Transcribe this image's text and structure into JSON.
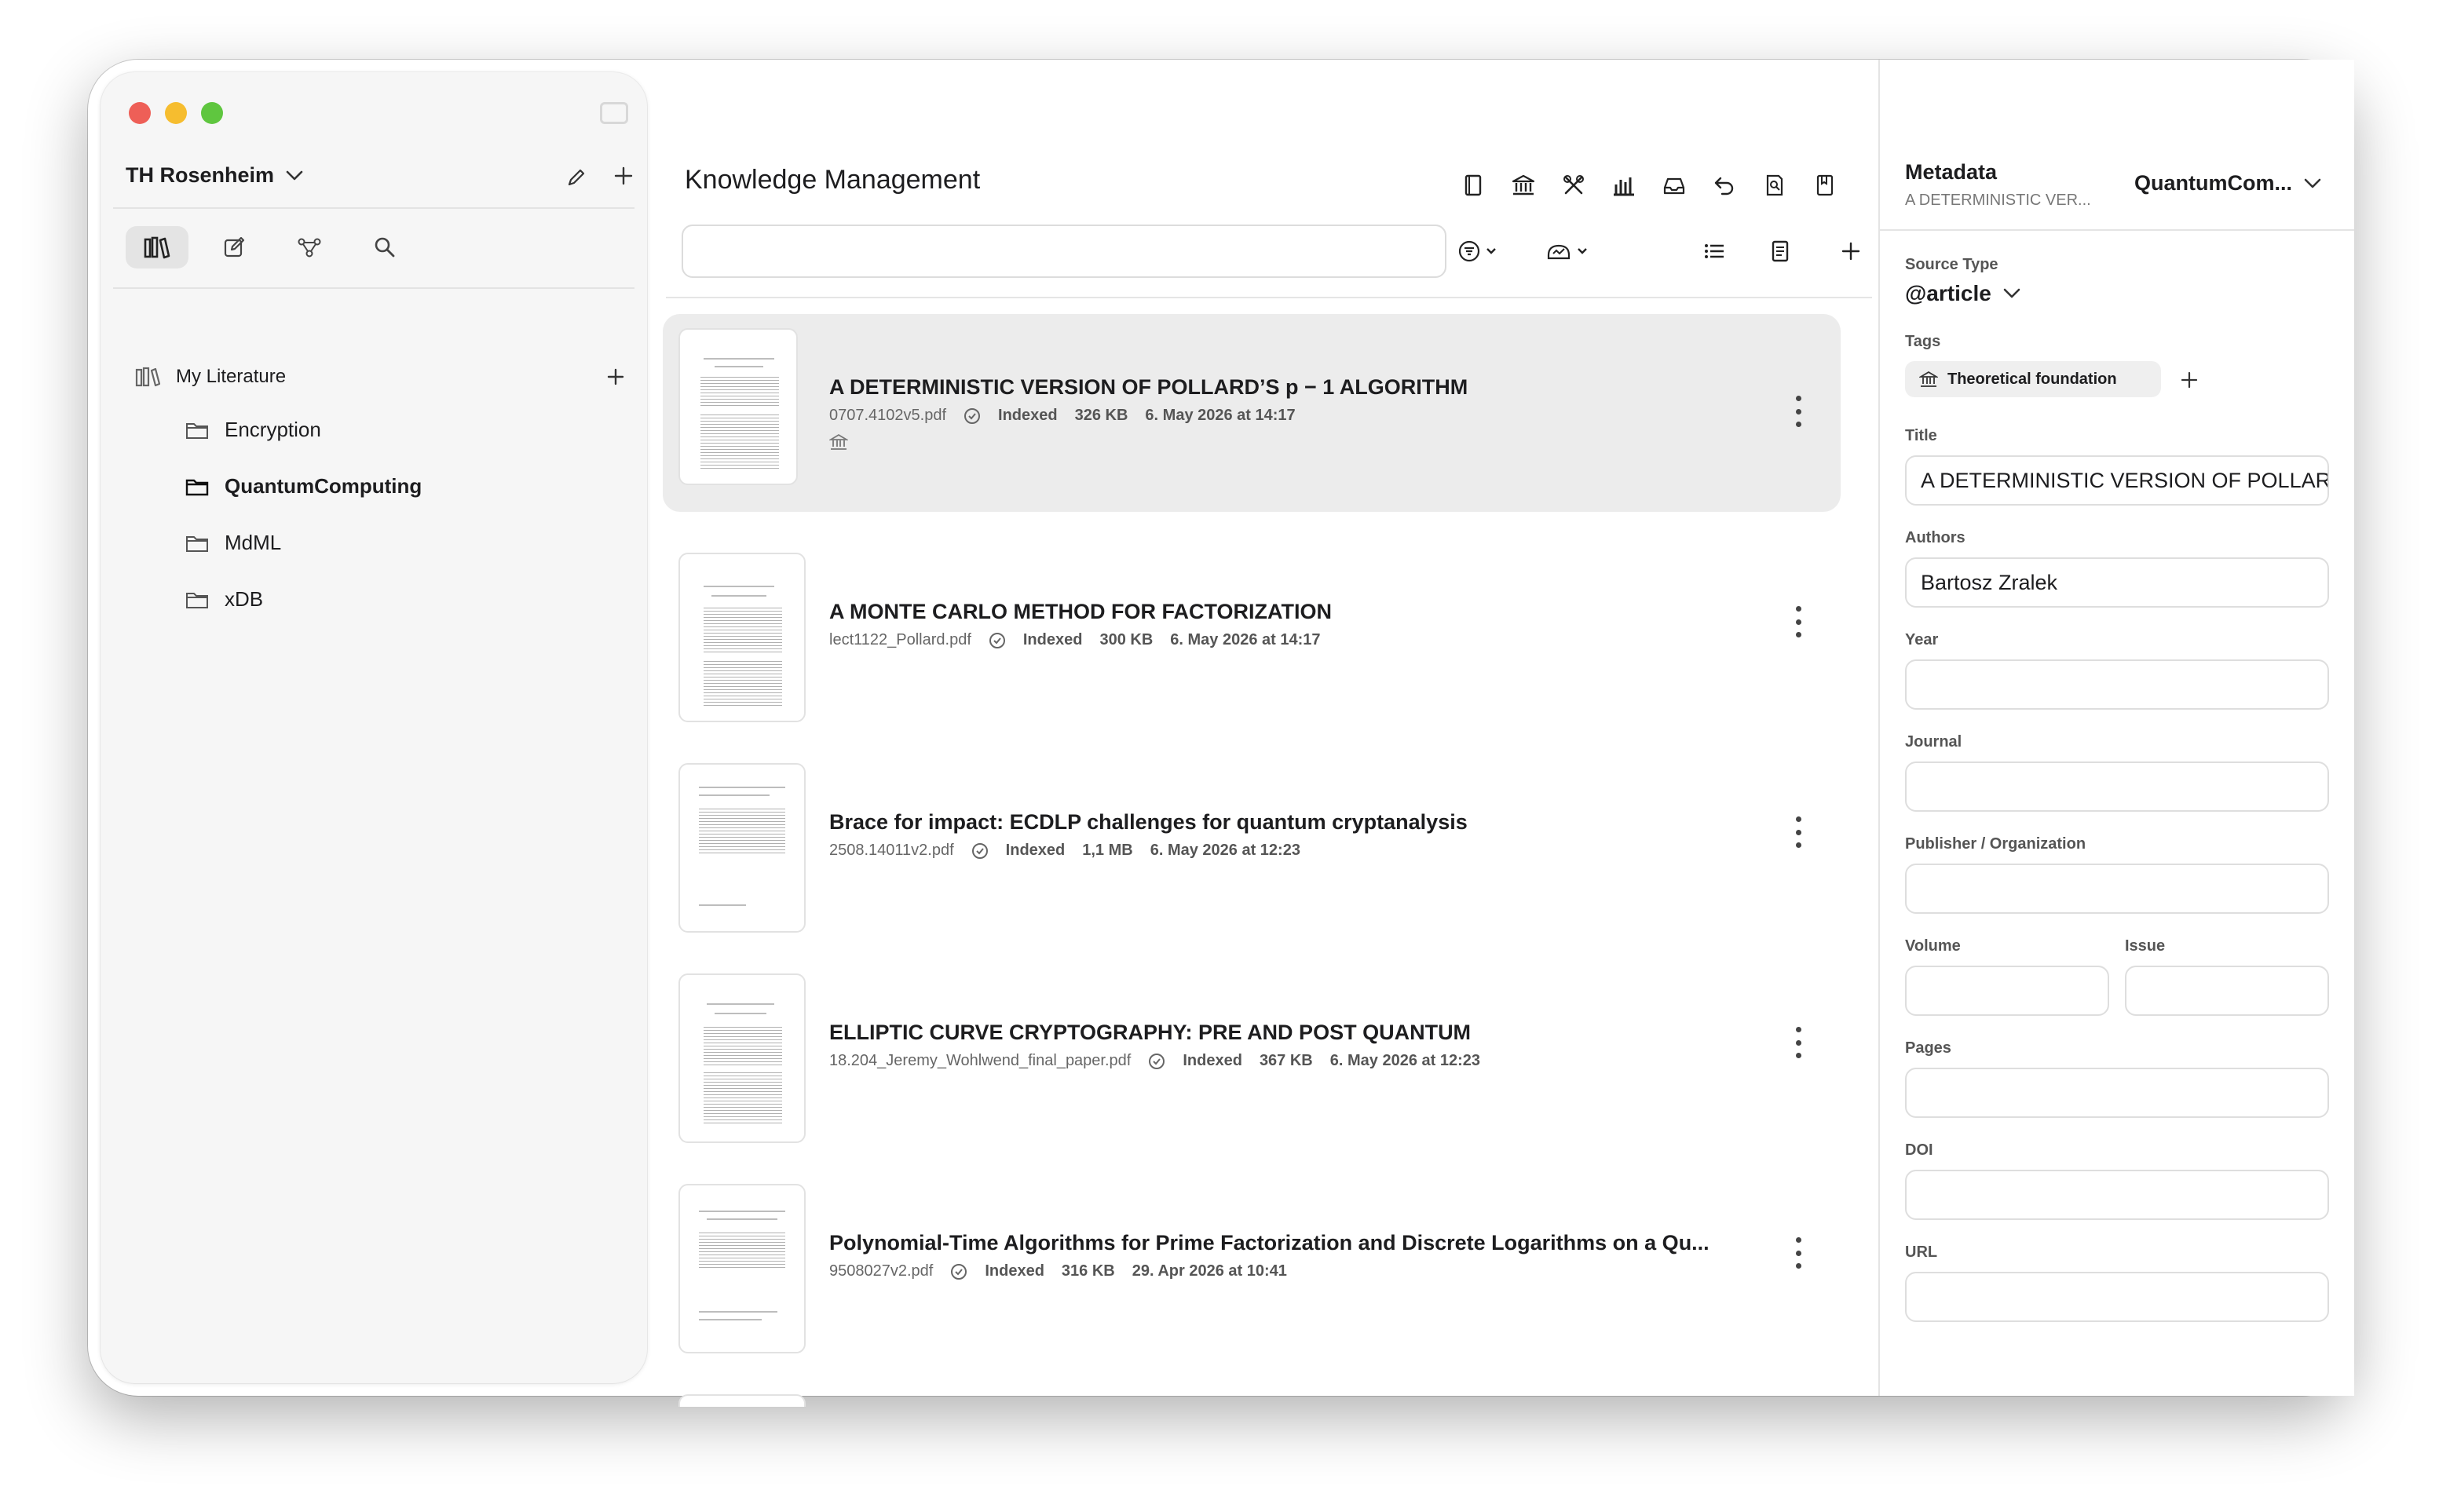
{
  "sidebar": {
    "library_name": "TH Rosenheim",
    "root_label": "My Literature",
    "folders": [
      {
        "label": "Encryption",
        "bold": false
      },
      {
        "label": "QuantumComputing",
        "bold": true
      },
      {
        "label": "MdML",
        "bold": false
      },
      {
        "label": "xDB",
        "bold": false
      }
    ]
  },
  "main": {
    "title": "Knowledge Management",
    "search_placeholder": "",
    "documents": [
      {
        "title": "A DETERMINISTIC VERSION OF POLLARD’S p − 1 ALGORITHM",
        "file": "0707.4102v5.pdf",
        "status": "Indexed",
        "size": "326 KB",
        "date": "6. May 2026 at 14:17",
        "selected": true
      },
      {
        "title": "A MONTE CARLO METHOD FOR FACTORIZATION",
        "file": "lect1122_Pollard.pdf",
        "status": "Indexed",
        "size": "300 KB",
        "date": "6. May 2026 at 14:17",
        "selected": false
      },
      {
        "title": "Brace for impact: ECDLP challenges for quantum cryptanalysis",
        "file": "2508.14011v2.pdf",
        "status": "Indexed",
        "size": "1,1 MB",
        "date": "6. May 2026 at 12:23",
        "selected": false
      },
      {
        "title": "ELLIPTIC CURVE CRYPTOGRAPHY: PRE AND POST QUANTUM",
        "file": "18.204_Jeremy_Wohlwend_final_paper.pdf",
        "status": "Indexed",
        "size": "367 KB",
        "date": "6. May 2026 at 12:23",
        "selected": false
      },
      {
        "title": "Polynomial-Time Algorithms for Prime Factorization and Discrete Logarithms on a Qu...",
        "file": "9508027v2.pdf",
        "status": "Indexed",
        "size": "316 KB",
        "date": "29. Apr 2026 at 10:41",
        "selected": false
      }
    ]
  },
  "metadata": {
    "heading": "Metadata",
    "subtitle": "A DETERMINISTIC VER...",
    "collection": "QuantumCom...",
    "source_type_label": "Source Type",
    "source_type_value": "@article",
    "tags_label": "Tags",
    "tag": "Theoretical foundation",
    "title_label": "Title",
    "title_value": "A DETERMINISTIC VERSION OF POLLARD",
    "authors_label": "Authors",
    "authors_value": "Bartosz Zralek",
    "year_label": "Year",
    "journal_label": "Journal",
    "publisher_label": "Publisher / Organization",
    "volume_label": "Volume",
    "issue_label": "Issue",
    "pages_label": "Pages",
    "doi_label": "DOI",
    "url_label": "URL"
  },
  "icons": [
    "edit-icon",
    "plus-icon",
    "library-icon",
    "note-icon",
    "graph-icon",
    "search-icon",
    "folder-icon",
    "book-icon",
    "institution-icon",
    "tools-icon",
    "chart-icon",
    "tray-icon",
    "undo-icon",
    "doc-search-icon",
    "bookmark-icon",
    "filter-icon",
    "drive-icon",
    "list-icon",
    "document-icon",
    "check-circle-icon",
    "more-icon",
    "chevron-down-icon"
  ]
}
